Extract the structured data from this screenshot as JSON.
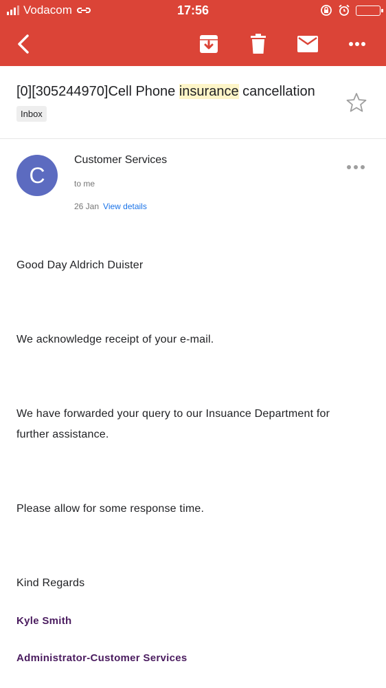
{
  "status_bar": {
    "carrier": "Vodacom",
    "time": "17:56"
  },
  "toolbar": {
    "back_icon": "back-arrow-icon",
    "archive_icon": "archive-icon",
    "delete_icon": "trash-icon",
    "mail_icon": "mark-unread-icon",
    "more_icon": "more-horizontal-icon",
    "color": "#db4437"
  },
  "email": {
    "subject_before": "[0][305244970]Cell Phone ",
    "subject_highlight": "insurance",
    "subject_after": " cancellation",
    "label": "Inbox",
    "avatar_letter": "C",
    "avatar_color": "#5c6bc0",
    "sender": "Customer Services",
    "to": "to me",
    "date": "26 Jan",
    "view_details": "View details",
    "body": {
      "greeting": "Good Day Aldrich Duister",
      "p1": "We acknowledge receipt of your e-mail.",
      "p2_line1": "We have forwarded your query  to our Insuance Department for",
      "p2_line2": "further assistance.",
      "p3": "Please allow for some response time.",
      "closing": "Kind Regards",
      "signature_name": "Kyle Smith",
      "signature_title": "Administrator-Customer Services"
    }
  }
}
